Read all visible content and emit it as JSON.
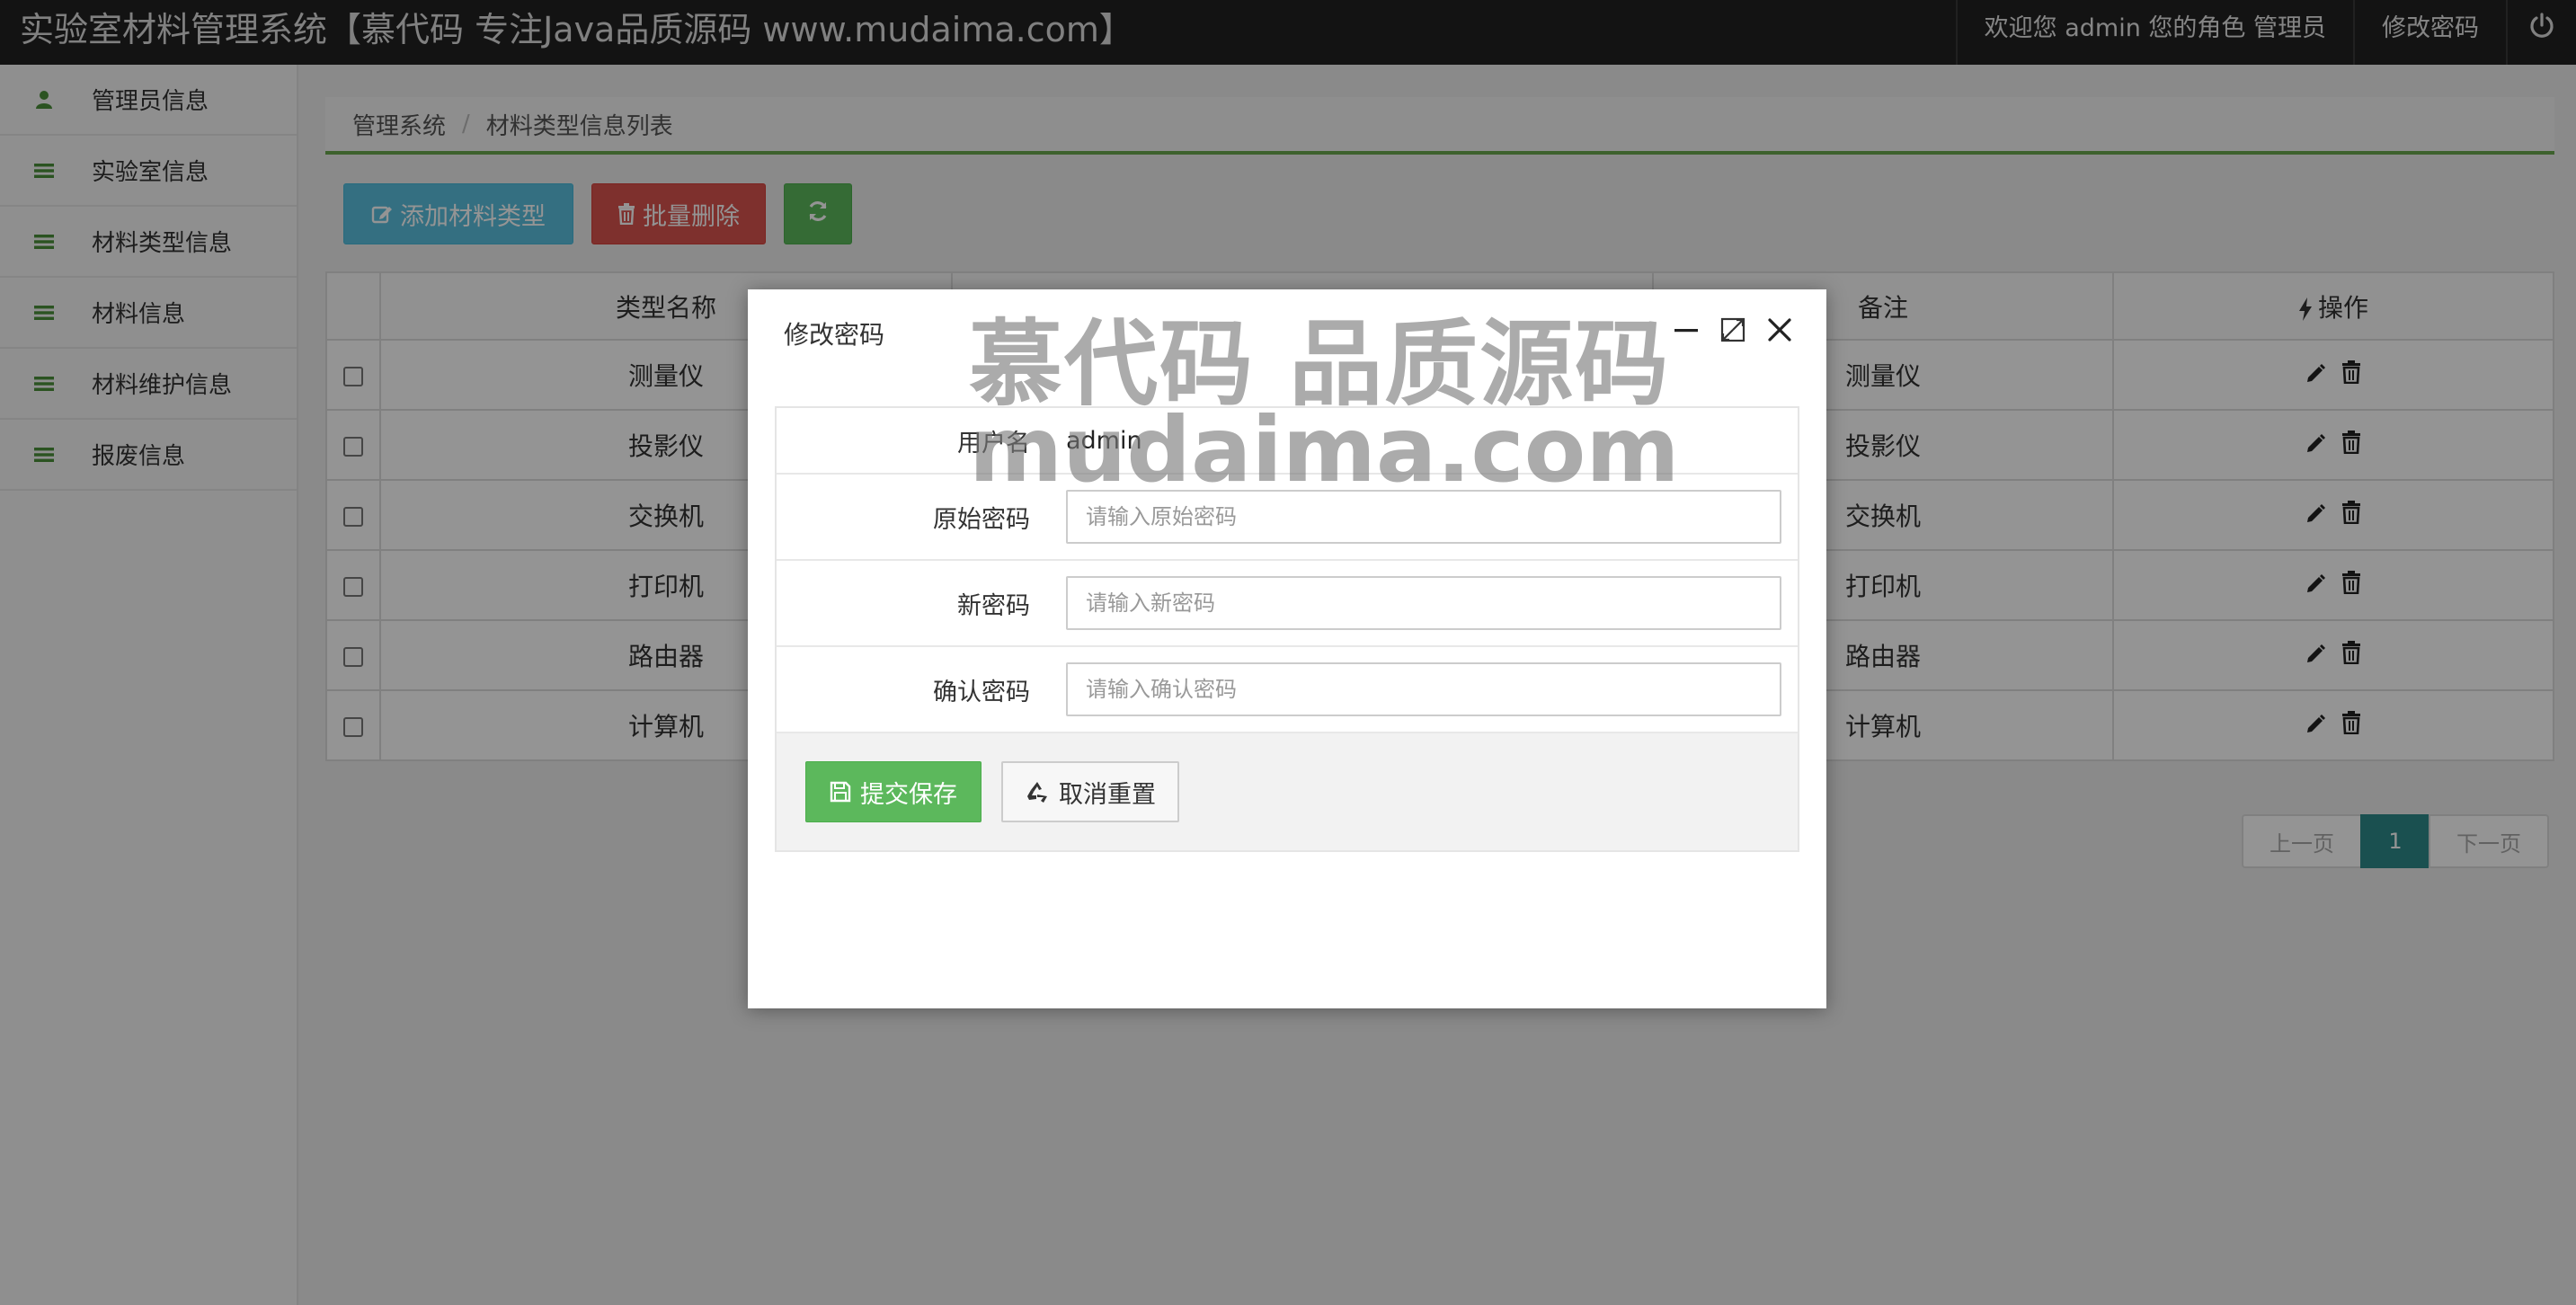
{
  "header": {
    "title": "实验室材料管理系统【慕代码 专注Java品质源码 www.mudaima.com】",
    "welcome": "欢迎您 admin 您的角色 管理员",
    "change_password": "修改密码",
    "power_icon": "power-icon"
  },
  "sidebar": {
    "items": [
      {
        "label": "管理员信息",
        "icon": "user-icon"
      },
      {
        "label": "实验室信息",
        "icon": "list-icon"
      },
      {
        "label": "材料类型信息",
        "icon": "list-icon"
      },
      {
        "label": "材料信息",
        "icon": "list-icon"
      },
      {
        "label": "材料维护信息",
        "icon": "list-icon"
      },
      {
        "label": "报废信息",
        "icon": "list-icon"
      }
    ]
  },
  "breadcrumb": {
    "root": "管理系统",
    "sep": "/",
    "current": "材料类型信息列表"
  },
  "toolbar": {
    "add_label": "添加材料类型",
    "batch_delete_label": "批量删除",
    "refresh_icon": "refresh-icon"
  },
  "table": {
    "headers": {
      "name": "类型名称",
      "remark": "备注",
      "ops": "操作"
    },
    "rows": [
      {
        "name": "测量仪",
        "remark": "测量仪"
      },
      {
        "name": "投影仪",
        "remark": "投影仪"
      },
      {
        "name": "交换机",
        "remark": "交换机"
      },
      {
        "name": "打印机",
        "remark": "打印机"
      },
      {
        "name": "路由器",
        "remark": "路由器"
      },
      {
        "name": "计算机",
        "remark": "计算机"
      }
    ]
  },
  "pagination": {
    "prev": "上一页",
    "current": "1",
    "next": "下一页"
  },
  "dialog": {
    "title": "修改密码",
    "username_label": "用户名",
    "username_value": "admin",
    "old_password_label": "原始密码",
    "old_password_placeholder": "请输入原始密码",
    "new_password_label": "新密码",
    "new_password_placeholder": "请输入新密码",
    "confirm_password_label": "确认密码",
    "confirm_password_placeholder": "请输入确认密码",
    "submit_label": "提交保存",
    "reset_label": "取消重置"
  },
  "watermark": {
    "line1": "慕代码 品质源码",
    "line2": "mudaima.com"
  },
  "colors": {
    "topbar": "#222222",
    "success": "#5cb85c",
    "danger": "#d9534f",
    "info": "#5bc0de",
    "pager_active": "#2e8b8b",
    "accent_green": "#6aa84f"
  }
}
